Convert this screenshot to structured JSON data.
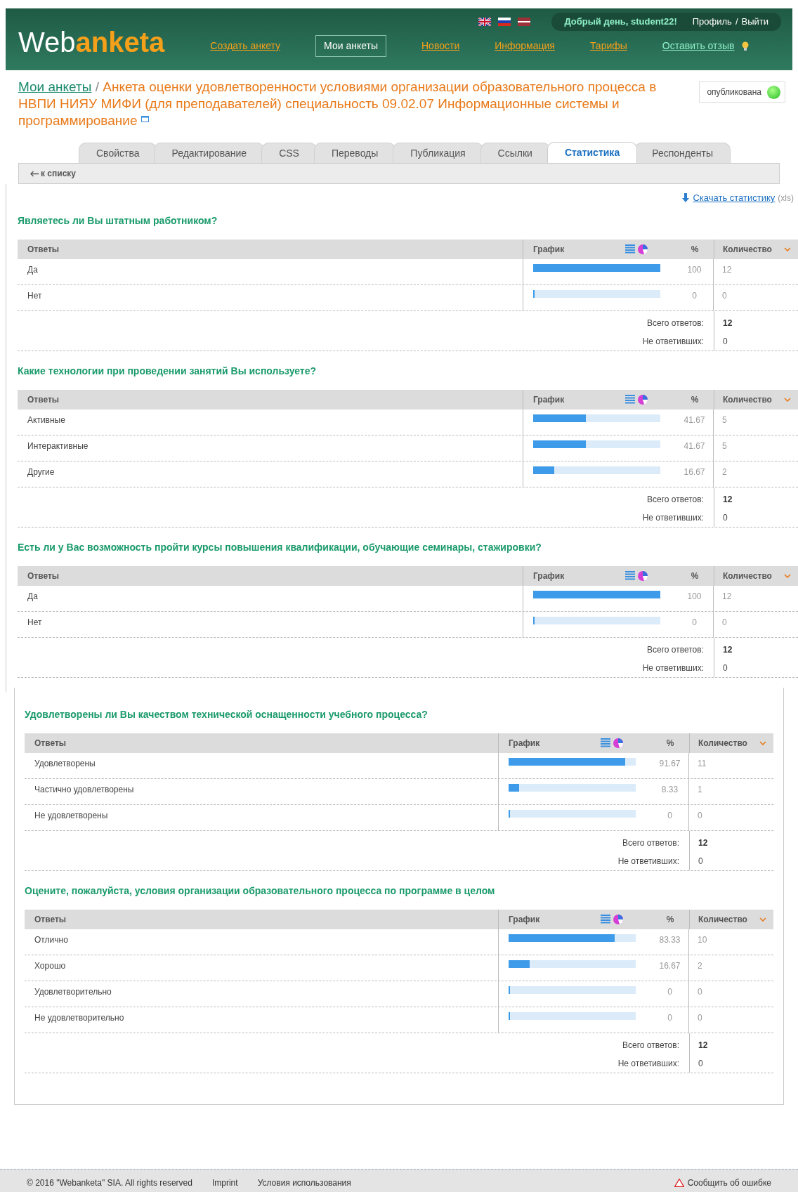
{
  "header": {
    "logo_parts": [
      "Web",
      "anketa"
    ],
    "greeting": "Добрый день, student22!",
    "profile": "Профиль",
    "separator": "/",
    "logout": "Выйти",
    "nav": [
      {
        "label": "Создать анкету",
        "selected": false
      },
      {
        "label": "Мои анкеты",
        "selected": true
      },
      {
        "label": "Новости",
        "selected": false
      },
      {
        "label": "Информация",
        "selected": false
      },
      {
        "label": "Тарифы",
        "selected": false
      },
      {
        "label": "Оставить отзыв",
        "selected": false
      }
    ]
  },
  "breadcrumb": {
    "parent": "Мои анкеты",
    "separator": "/",
    "title": "Анкета оценки удовлетворенности условиями организации образовательного процесса в НВПИ НИЯУ МИФИ (для преподавателей) специальность 09.02.07 Информационные системы и программирование"
  },
  "status": {
    "label": "опубликована",
    "published": true
  },
  "tabs": [
    {
      "label": "Свойства",
      "selected": false
    },
    {
      "label": "Редактирование",
      "selected": false
    },
    {
      "label": "CSS",
      "selected": false
    },
    {
      "label": "Переводы",
      "selected": false
    },
    {
      "label": "Публикация",
      "selected": false
    },
    {
      "label": "Ссылки",
      "selected": false
    },
    {
      "label": "Статистика",
      "selected": true
    },
    {
      "label": "Респонденты",
      "selected": false
    }
  ],
  "back_link": "к списку",
  "download": {
    "label": "Скачать статистику",
    "format": "(xls)"
  },
  "sections": [
    {
      "question": "Являетесь ли Вы штатным работником?",
      "columns": [
        "Ответы",
        "График",
        "%",
        "Количество"
      ],
      "rows": [
        {
          "answer": "Да",
          "level": 1,
          "percent": "100",
          "count": "12"
        },
        {
          "answer": "Нет",
          "level": 0,
          "percent": "0",
          "count": "0"
        }
      ],
      "total_label": "Всего ответов:",
      "total": "12",
      "unanswered_label": "Не ответивших:",
      "unanswered": "0"
    },
    {
      "question": "Какие технологии при проведении занятий Вы используете?",
      "columns": [
        "Ответы",
        "График",
        "%",
        "Количество"
      ],
      "rows": [
        {
          "answer": "Активные",
          "level": 0.4167,
          "percent": "41.67",
          "count": "5"
        },
        {
          "answer": "Интерактивные",
          "level": 0.4167,
          "percent": "41.67",
          "count": "5"
        },
        {
          "answer": "Другие",
          "level": 0.1667,
          "percent": "16.67",
          "count": "2"
        }
      ],
      "total_label": "Всего ответов:",
      "total": "12",
      "unanswered_label": "Не ответивших:",
      "unanswered": "0"
    },
    {
      "question": "Есть ли у Вас возможность пройти курсы повышения квалификации, обучающие семинары, стажировки?",
      "columns": [
        "Ответы",
        "График",
        "%",
        "Количество"
      ],
      "rows": [
        {
          "answer": "Да",
          "level": 1,
          "percent": "100",
          "count": "12"
        },
        {
          "answer": "Нет",
          "level": 0,
          "percent": "0",
          "count": "0"
        }
      ],
      "total_label": "Всего ответов:",
      "total": "12",
      "unanswered_label": "Не ответивших:",
      "unanswered": "0"
    },
    {
      "question": "Удовлетворены ли Вы качеством технической оснащенности учебного процесса?",
      "columns": [
        "Ответы",
        "График",
        "%",
        "Количество"
      ],
      "rows": [
        {
          "answer": "Удовлетворены",
          "level": 0.9167,
          "percent": "91.67",
          "count": "11"
        },
        {
          "answer": "Частично удовлетворены",
          "level": 0.0833,
          "percent": "8.33",
          "count": "1"
        },
        {
          "answer": "Не удовлетворены",
          "level": 0,
          "percent": "0",
          "count": "0"
        }
      ],
      "total_label": "Всего ответов:",
      "total": "12",
      "unanswered_label": "Не ответивших:",
      "unanswered": "0"
    },
    {
      "question": "Оцените, пожалуйста, условия организации образовательного процесса по программе в целом",
      "columns": [
        "Ответы",
        "График",
        "%",
        "Количество"
      ],
      "rows": [
        {
          "answer": "Отлично",
          "level": 0.8333,
          "percent": "83.33",
          "count": "10"
        },
        {
          "answer": "Хорошо",
          "level": 0.1667,
          "percent": "16.67",
          "count": "2"
        },
        {
          "answer": "Удовлетворительно",
          "level": 0,
          "percent": "0",
          "count": "0"
        },
        {
          "answer": "Не удовлетворительно",
          "level": 0,
          "percent": "0",
          "count": "0"
        }
      ],
      "total_label": "Всего ответов:",
      "total": "12",
      "unanswered_label": "Не ответивших:",
      "unanswered": "0"
    }
  ],
  "footer": {
    "copyright": "© 2016 \"Webanketa\" SIA. All rights reserved",
    "links": [
      "Imprint",
      "Условия использования"
    ],
    "report": "Сообщить об ошибке"
  }
}
